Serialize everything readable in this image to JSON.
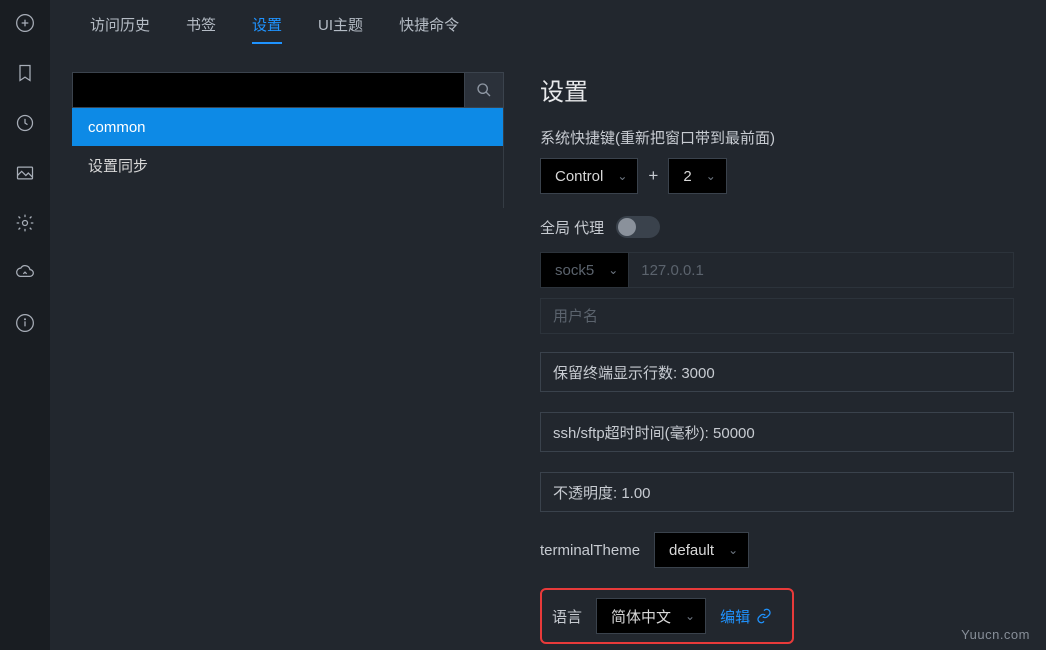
{
  "tabs": {
    "history": "访问历史",
    "bookmarks": "书签",
    "settings": "设置",
    "theme": "UI主题",
    "commands": "快捷命令"
  },
  "sidebar": {
    "items": [
      {
        "label": "common",
        "selected": true
      },
      {
        "label": "设置同步",
        "selected": false
      }
    ]
  },
  "page": {
    "title": "设置",
    "shortcut_label": "系统快捷键(重新把窗口带到最前面)",
    "shortcut_modifier": "Control",
    "shortcut_plus": "+",
    "shortcut_key": "2",
    "global_proxy_label": "全局 代理",
    "proxy_protocol": "sock5",
    "proxy_host_placeholder": "127.0.0.1",
    "proxy_user_placeholder": "用户名",
    "scrollback_value": "保留终端显示行数: 3000",
    "timeout_value": "ssh/sftp超时时间(毫秒): 50000",
    "opacity_value": "不透明度: 1.00",
    "terminal_theme_label": "terminalTheme",
    "terminal_theme_value": "default",
    "language_label": "语言",
    "language_value": "简体中文",
    "edit_label": "编辑"
  },
  "watermark": "Yuucn.com"
}
